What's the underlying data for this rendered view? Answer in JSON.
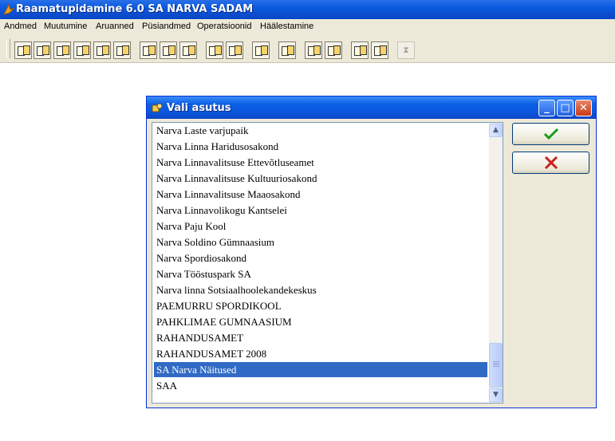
{
  "app": {
    "title": "Raamatupidamine 6.0 SA NARVA SADAM"
  },
  "menu": [
    {
      "label": "Andmed"
    },
    {
      "label": "Muutumine"
    },
    {
      "label": "Aruanned"
    },
    {
      "label": "Püsiandmed"
    },
    {
      "label": "Operatsioonid"
    },
    {
      "label": "Häälestamine"
    }
  ],
  "toolbar": {
    "icons": [
      "toolbar-icon"
    ]
  },
  "dialog": {
    "title": "Vali asutus",
    "items": [
      "Narva Laste varjupaik",
      "Narva Linna Haridusosakond",
      "Narva Linnavalitsuse Ettevõtluseamet",
      "Narva Linnavalitsuse Kultuuriosakond",
      "Narva Linnavalitsuse Maaosakond",
      "Narva Linnavolikogu Kantselei",
      "Narva Paju Kool",
      "Narva Soldino Gümnaasium",
      "Narva Spordiosakond",
      "Narva Tööstuspark SA",
      "Narva linna Sotsiaalhoolekandekeskus",
      "PAEMURRU SPORDIKOOL",
      "PAHKLIMAE GUMNAASIUM",
      "RAHANDUSAMET",
      "RAHANDUSAMET 2008",
      "SA Narva Näitused",
      "SAA"
    ],
    "selected": "SA Narva Näitused",
    "ok_icon": "green-check-icon",
    "cancel_icon": "red-x-icon"
  },
  "colors": {
    "titlebar": "#0a5ae0",
    "selection": "#316ac5",
    "face": "#ece9d8"
  }
}
